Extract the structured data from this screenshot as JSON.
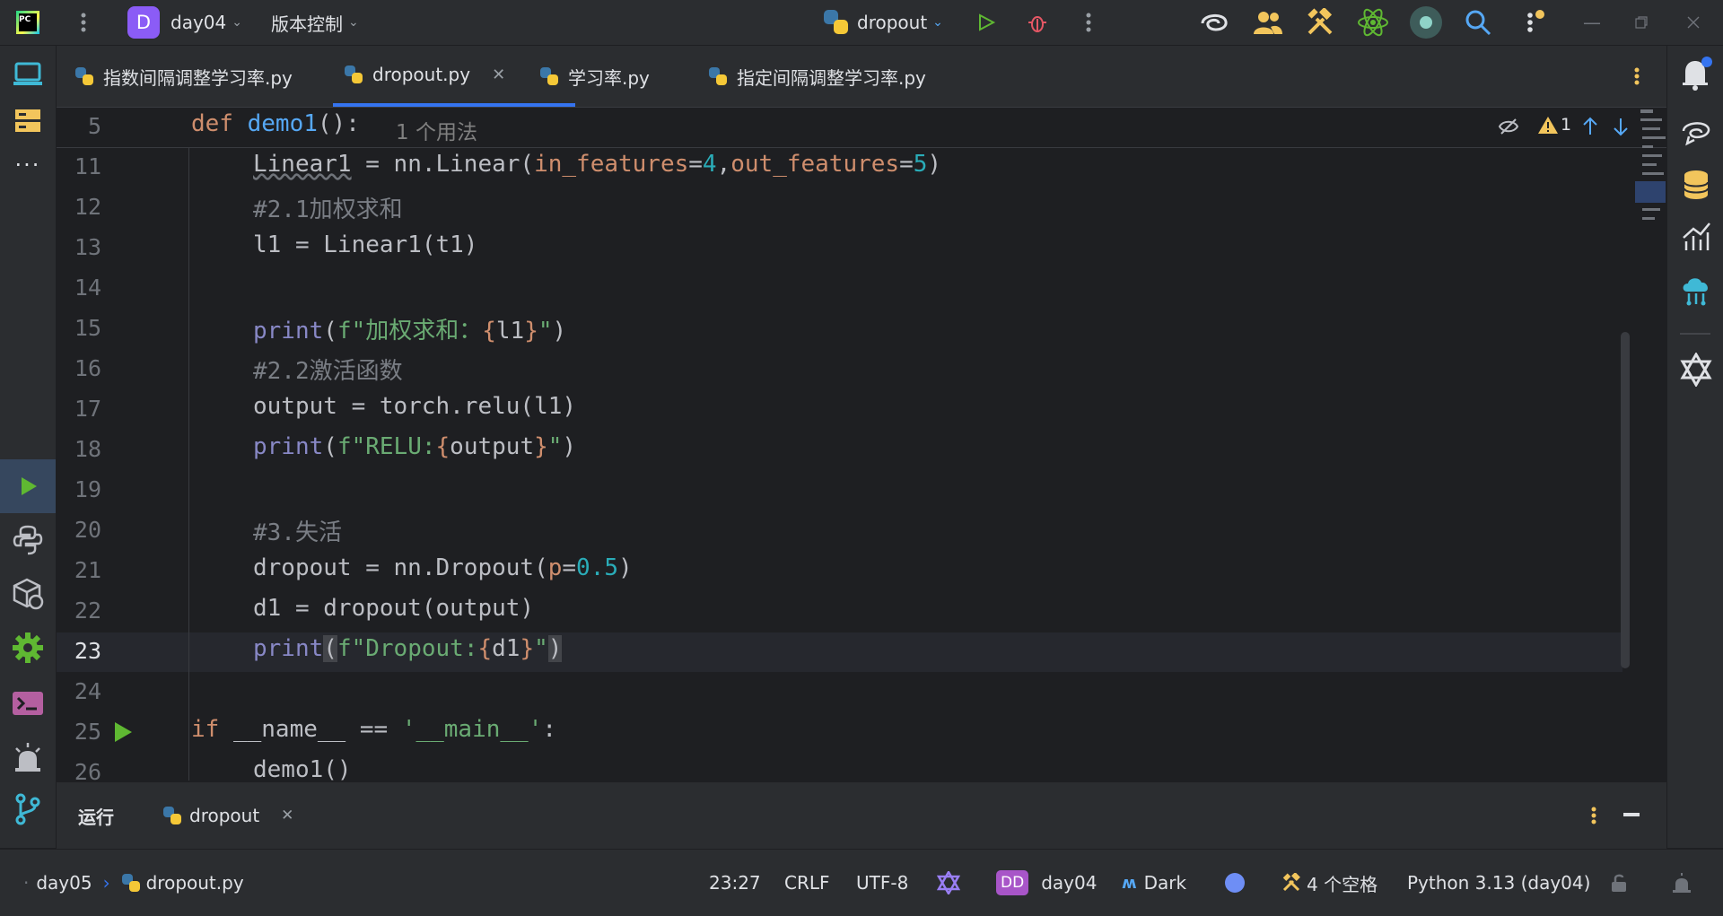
{
  "titlebar": {
    "project_initial": "D",
    "project_name": "day04",
    "vcs_label": "版本控制",
    "run_config": "dropout"
  },
  "tabs": [
    {
      "label": "指数间隔调整学习率.py",
      "active": false
    },
    {
      "label": "dropout.py",
      "active": true
    },
    {
      "label": "学习率.py",
      "active": false
    },
    {
      "label": "指定间隔调整学习率.py",
      "active": false
    }
  ],
  "editor": {
    "sticky": {
      "line": "5",
      "code_def": "def",
      "code_name": "demo1",
      "code_tail": "():",
      "usages": "1 个用法"
    },
    "inspection_count": "1",
    "lines": [
      {
        "no": "11"
      },
      {
        "no": "12"
      },
      {
        "no": "13"
      },
      {
        "no": "14"
      },
      {
        "no": "15"
      },
      {
        "no": "16"
      },
      {
        "no": "17"
      },
      {
        "no": "18"
      },
      {
        "no": "19"
      },
      {
        "no": "20"
      },
      {
        "no": "21"
      },
      {
        "no": "22"
      },
      {
        "no": "23"
      },
      {
        "no": "24"
      },
      {
        "no": "25"
      },
      {
        "no": "26"
      }
    ],
    "code": {
      "l11_a": "Linear1",
      "l11_b": " = nn.Linear(",
      "l11_p1": "in_features",
      "l11_eq1": "=",
      "l11_n1": "4",
      "l11_c": ",",
      "l11_p2": "out_features",
      "l11_eq2": "=",
      "l11_n2": "5",
      "l11_e": ")",
      "l12": "#2.1加权求和",
      "l13": "l1 = Linear1(t1)",
      "l15_a": "print",
      "l15_b": "(",
      "l15_s1": "f\"加权求和：",
      "l15_br1": "{",
      "l15_v": "l1",
      "l15_br2": "}",
      "l15_s2": "\"",
      "l15_e": ")",
      "l16": "#2.2激活函数",
      "l17": "output = torch.relu(l1)",
      "l18_a": "print",
      "l18_b": "(",
      "l18_s1": "f\"RELU:",
      "l18_br1": "{",
      "l18_v": "output",
      "l18_br2": "}",
      "l18_s2": "\"",
      "l18_e": ")",
      "l20": "#3.失活",
      "l21_a": "dropout = nn.Dropout(",
      "l21_p": "p",
      "l21_eq": "=",
      "l21_n": "0.5",
      "l21_e": ")",
      "l22": "d1 = dropout(output)",
      "l23_a": "print",
      "l23_b": "(",
      "l23_s1": "f\"Dropout:",
      "l23_br1": "{",
      "l23_v": "d1",
      "l23_br2": "}",
      "l23_s2": "\"",
      "l23_e": ")",
      "l25_kw": "if",
      "l25_a": " __name__ == ",
      "l25_s": "'__main__'",
      "l25_e": ":",
      "l26": "demo1()"
    }
  },
  "bottom_panel": {
    "run_label": "运行",
    "run_tab": "dropout"
  },
  "statusbar": {
    "crumb1": "day05",
    "crumb2": "dropout.py",
    "position": "23:27",
    "line_sep": "CRLF",
    "encoding": "UTF-8",
    "project_badge": "DD",
    "project": "day04",
    "theme": "Dark",
    "indent": "4 个空格",
    "interpreter": "Python 3.13 (day04)"
  },
  "colors": {
    "accent": "#3574f0",
    "run_green": "#5fb832",
    "warning": "#f2c55c"
  }
}
